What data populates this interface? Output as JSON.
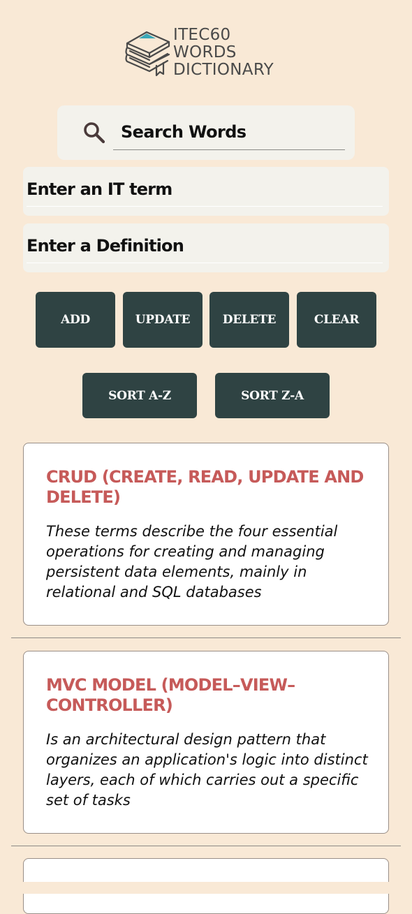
{
  "logo": {
    "lines": [
      "ITEC60",
      "WORDS",
      "DICTIONARY"
    ],
    "icon": "stacked-books-icon"
  },
  "search": {
    "icon": "search-icon",
    "placeholder": "Search Words",
    "value": ""
  },
  "form": {
    "term_placeholder": "Enter an IT term",
    "definition_placeholder": "Enter a Definition"
  },
  "actions": {
    "add_label": "ADD",
    "update_label": "UPDATE",
    "delete_label": "DELETE",
    "clear_label": "CLEAR",
    "sort_az_label": "SORT A-Z",
    "sort_za_label": "SORT Z-A"
  },
  "words": [
    {
      "term": "CRUD (Create, Read, Update and Delete)",
      "definition": "These terms describe the four essential operations for creating and managing persistent data elements, mainly in relational and SQL databases"
    },
    {
      "term": "MVC Model (Model–View–Controller)",
      "definition": "Is an architectural design pattern that organizes an application's logic into distinct layers, each of which carries out a specific set of tasks"
    }
  ],
  "colors": {
    "background": "#f9e9d6",
    "button": "#2f4343",
    "term_title": "#c65a59",
    "logo_accent": "#3aa8b8"
  }
}
